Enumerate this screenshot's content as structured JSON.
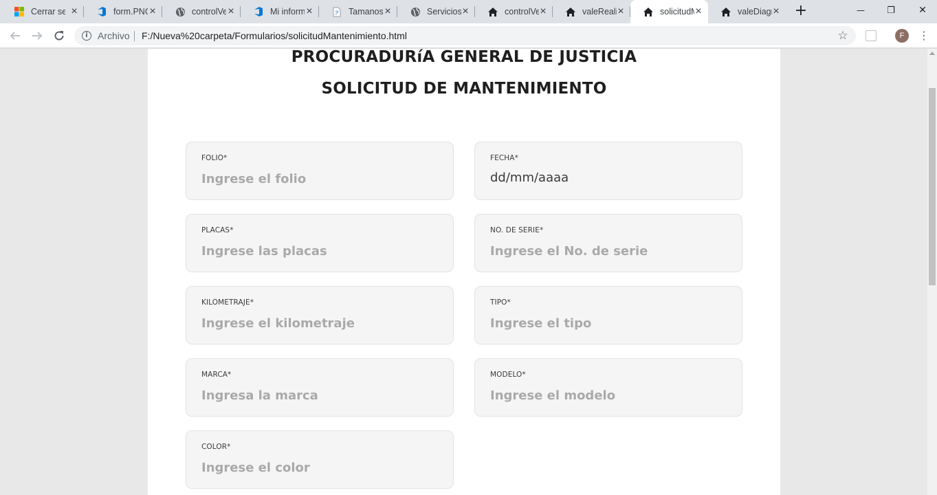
{
  "browser": {
    "tabs": [
      {
        "title": "Cerrar sesión",
        "icon": "windows-logo-icon",
        "active": false
      },
      {
        "title": "form.PNG",
        "icon": "azure-devops-icon",
        "active": false
      },
      {
        "title": "controlVehicular",
        "icon": "globe-icon",
        "active": false
      },
      {
        "title": "Mi información",
        "icon": "azure-devops-icon",
        "active": false
      },
      {
        "title": "Tamanos",
        "icon": "document-icon",
        "active": false
      },
      {
        "title": "Servicios",
        "icon": "globe-icon",
        "active": false
      },
      {
        "title": "controlVehicular",
        "icon": "home-icon",
        "active": false
      },
      {
        "title": "valeRealizado",
        "icon": "home-icon",
        "active": false
      },
      {
        "title": "solicitudMantenimiento",
        "icon": "home-icon",
        "active": true
      },
      {
        "title": "valeDiagnostico",
        "icon": "home-icon",
        "active": false
      }
    ],
    "new_tab_glyph": "+",
    "window_controls": {
      "minimize": "—",
      "restore": "❐",
      "close": "✕"
    },
    "address": {
      "scheme_label": "Archivo",
      "url": "F:/Nueva%20carpeta/Formularios/solicitudMantenimiento.html"
    },
    "profile_initial": "F"
  },
  "page": {
    "title_line1": "PROCURADURíA GENERAL DE JUSTICIA",
    "title_line2": "SOLICITUD DE MANTENIMIENTO",
    "fields": {
      "folio": {
        "label": "FOLIO*",
        "placeholder": "Ingrese el folio"
      },
      "fecha": {
        "label": "FECHA*",
        "value": "dd/mm/aaaa"
      },
      "placas": {
        "label": "PLACAS*",
        "placeholder": "Ingrese las placas"
      },
      "serie": {
        "label": "NO. DE SERIE*",
        "placeholder": "Ingrese el No. de serie"
      },
      "kilometraje": {
        "label": "KILOMETRAJE*",
        "placeholder": "Ingrese el kilometraje"
      },
      "tipo": {
        "label": "TIPO*",
        "placeholder": "Ingrese el tipo"
      },
      "marca": {
        "label": "MARCA*",
        "placeholder": "Ingresa la marca"
      },
      "modelo": {
        "label": "MODELO*",
        "placeholder": "Ingrese el modelo"
      },
      "color": {
        "label": "COLOR*",
        "placeholder": "Ingrese el color"
      }
    }
  }
}
